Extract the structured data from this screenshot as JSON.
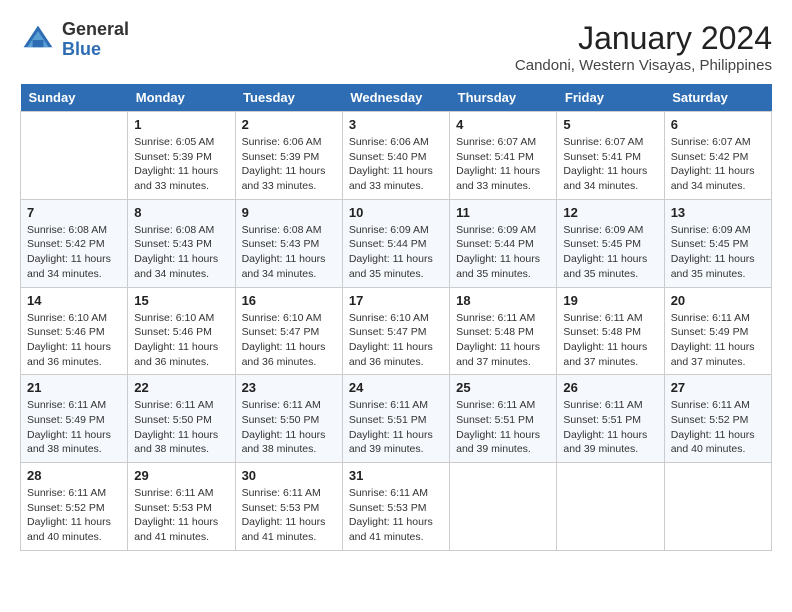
{
  "header": {
    "logo_general": "General",
    "logo_blue": "Blue",
    "month_year": "January 2024",
    "location": "Candoni, Western Visayas, Philippines"
  },
  "days_of_week": [
    "Sunday",
    "Monday",
    "Tuesday",
    "Wednesday",
    "Thursday",
    "Friday",
    "Saturday"
  ],
  "weeks": [
    [
      {
        "day": "",
        "info": ""
      },
      {
        "day": "1",
        "info": "Sunrise: 6:05 AM\nSunset: 5:39 PM\nDaylight: 11 hours\nand 33 minutes."
      },
      {
        "day": "2",
        "info": "Sunrise: 6:06 AM\nSunset: 5:39 PM\nDaylight: 11 hours\nand 33 minutes."
      },
      {
        "day": "3",
        "info": "Sunrise: 6:06 AM\nSunset: 5:40 PM\nDaylight: 11 hours\nand 33 minutes."
      },
      {
        "day": "4",
        "info": "Sunrise: 6:07 AM\nSunset: 5:41 PM\nDaylight: 11 hours\nand 33 minutes."
      },
      {
        "day": "5",
        "info": "Sunrise: 6:07 AM\nSunset: 5:41 PM\nDaylight: 11 hours\nand 34 minutes."
      },
      {
        "day": "6",
        "info": "Sunrise: 6:07 AM\nSunset: 5:42 PM\nDaylight: 11 hours\nand 34 minutes."
      }
    ],
    [
      {
        "day": "7",
        "info": "Sunrise: 6:08 AM\nSunset: 5:42 PM\nDaylight: 11 hours\nand 34 minutes."
      },
      {
        "day": "8",
        "info": "Sunrise: 6:08 AM\nSunset: 5:43 PM\nDaylight: 11 hours\nand 34 minutes."
      },
      {
        "day": "9",
        "info": "Sunrise: 6:08 AM\nSunset: 5:43 PM\nDaylight: 11 hours\nand 34 minutes."
      },
      {
        "day": "10",
        "info": "Sunrise: 6:09 AM\nSunset: 5:44 PM\nDaylight: 11 hours\nand 35 minutes."
      },
      {
        "day": "11",
        "info": "Sunrise: 6:09 AM\nSunset: 5:44 PM\nDaylight: 11 hours\nand 35 minutes."
      },
      {
        "day": "12",
        "info": "Sunrise: 6:09 AM\nSunset: 5:45 PM\nDaylight: 11 hours\nand 35 minutes."
      },
      {
        "day": "13",
        "info": "Sunrise: 6:09 AM\nSunset: 5:45 PM\nDaylight: 11 hours\nand 35 minutes."
      }
    ],
    [
      {
        "day": "14",
        "info": "Sunrise: 6:10 AM\nSunset: 5:46 PM\nDaylight: 11 hours\nand 36 minutes."
      },
      {
        "day": "15",
        "info": "Sunrise: 6:10 AM\nSunset: 5:46 PM\nDaylight: 11 hours\nand 36 minutes."
      },
      {
        "day": "16",
        "info": "Sunrise: 6:10 AM\nSunset: 5:47 PM\nDaylight: 11 hours\nand 36 minutes."
      },
      {
        "day": "17",
        "info": "Sunrise: 6:10 AM\nSunset: 5:47 PM\nDaylight: 11 hours\nand 36 minutes."
      },
      {
        "day": "18",
        "info": "Sunrise: 6:11 AM\nSunset: 5:48 PM\nDaylight: 11 hours\nand 37 minutes."
      },
      {
        "day": "19",
        "info": "Sunrise: 6:11 AM\nSunset: 5:48 PM\nDaylight: 11 hours\nand 37 minutes."
      },
      {
        "day": "20",
        "info": "Sunrise: 6:11 AM\nSunset: 5:49 PM\nDaylight: 11 hours\nand 37 minutes."
      }
    ],
    [
      {
        "day": "21",
        "info": "Sunrise: 6:11 AM\nSunset: 5:49 PM\nDaylight: 11 hours\nand 38 minutes."
      },
      {
        "day": "22",
        "info": "Sunrise: 6:11 AM\nSunset: 5:50 PM\nDaylight: 11 hours\nand 38 minutes."
      },
      {
        "day": "23",
        "info": "Sunrise: 6:11 AM\nSunset: 5:50 PM\nDaylight: 11 hours\nand 38 minutes."
      },
      {
        "day": "24",
        "info": "Sunrise: 6:11 AM\nSunset: 5:51 PM\nDaylight: 11 hours\nand 39 minutes."
      },
      {
        "day": "25",
        "info": "Sunrise: 6:11 AM\nSunset: 5:51 PM\nDaylight: 11 hours\nand 39 minutes."
      },
      {
        "day": "26",
        "info": "Sunrise: 6:11 AM\nSunset: 5:51 PM\nDaylight: 11 hours\nand 39 minutes."
      },
      {
        "day": "27",
        "info": "Sunrise: 6:11 AM\nSunset: 5:52 PM\nDaylight: 11 hours\nand 40 minutes."
      }
    ],
    [
      {
        "day": "28",
        "info": "Sunrise: 6:11 AM\nSunset: 5:52 PM\nDaylight: 11 hours\nand 40 minutes."
      },
      {
        "day": "29",
        "info": "Sunrise: 6:11 AM\nSunset: 5:53 PM\nDaylight: 11 hours\nand 41 minutes."
      },
      {
        "day": "30",
        "info": "Sunrise: 6:11 AM\nSunset: 5:53 PM\nDaylight: 11 hours\nand 41 minutes."
      },
      {
        "day": "31",
        "info": "Sunrise: 6:11 AM\nSunset: 5:53 PM\nDaylight: 11 hours\nand 41 minutes."
      },
      {
        "day": "",
        "info": ""
      },
      {
        "day": "",
        "info": ""
      },
      {
        "day": "",
        "info": ""
      }
    ]
  ]
}
